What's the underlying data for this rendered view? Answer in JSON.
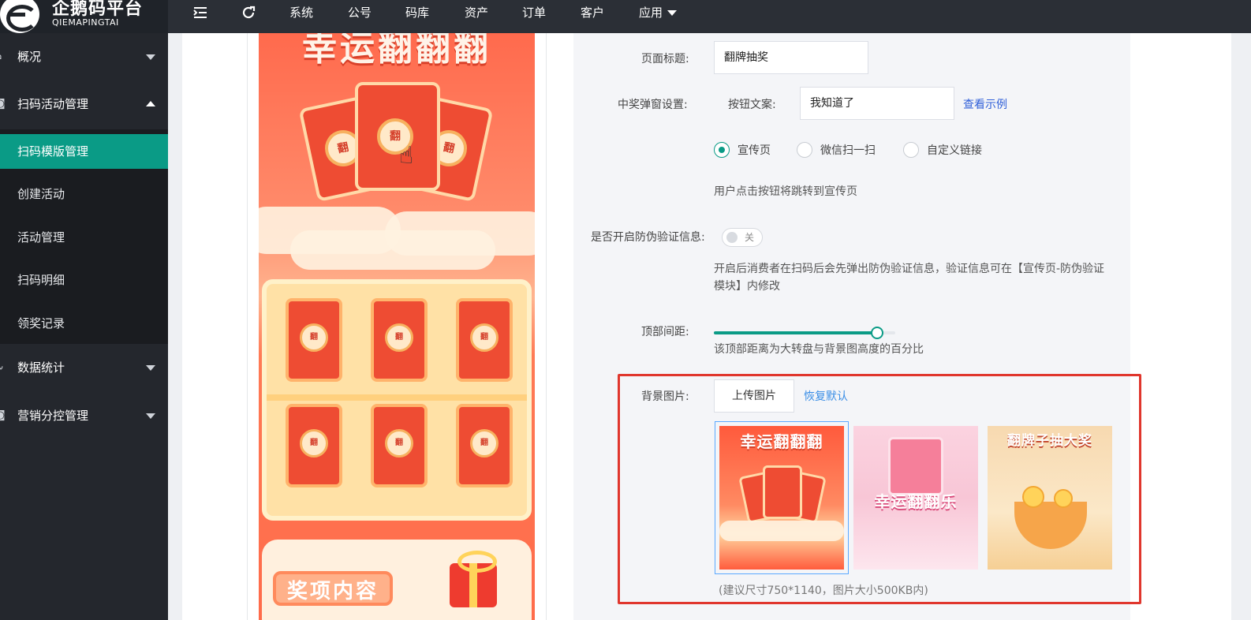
{
  "brand": {
    "name_cn": "企鹅码平台",
    "name_en": "QIEMAPINGTAI"
  },
  "topnav": {
    "items": [
      "系统",
      "公号",
      "码库",
      "资产",
      "订单",
      "客户",
      "应用"
    ],
    "icons": [
      "menu-fold-icon",
      "refresh-icon"
    ]
  },
  "sidebar": {
    "groups": [
      {
        "label": "概况",
        "icon": "home-icon",
        "expanded": false
      },
      {
        "label": "扫码活动管理",
        "icon": "camera-icon",
        "expanded": true
      },
      {
        "label": "数据统计",
        "icon": "pulse-icon",
        "expanded": false
      },
      {
        "label": "营销分控管理",
        "icon": "camera-icon",
        "expanded": false
      }
    ],
    "subitems": [
      "扫码模版管理",
      "创建活动",
      "活动管理",
      "扫码明细",
      "领奖记录"
    ],
    "active_subitem": "扫码模版管理"
  },
  "preview": {
    "title": "幸运翻翻翻",
    "card_text": "翻",
    "prize_label": "奖项内容"
  },
  "form": {
    "page_title_label": "页面标题:",
    "page_title_value": "翻牌抽奖",
    "popup_label": "中奖弹窗设置:",
    "button_text_label": "按钮文案:",
    "button_text_value": "我知道了",
    "view_example": "查看示例",
    "radios": [
      {
        "label": "宣传页",
        "checked": true
      },
      {
        "label": "微信扫一扫",
        "checked": false
      },
      {
        "label": "自定义链接",
        "checked": false
      }
    ],
    "redirect_hint": "用户点击按钮将跳转到宣传页",
    "anti_fake_label": "是否开启防伪验证信息:",
    "anti_fake_switch": "关",
    "anti_fake_on": false,
    "anti_fake_hint": "开启后消费者在扫码后会先弹出防伪验证信息，验证信息可在【宣传页-防伪验证模块】内修改",
    "top_spacing_label": "顶部间距:",
    "top_spacing_value": 0.9,
    "top_spacing_hint": "该顶部距离为大转盘与背景图高度的百分比",
    "bg_label": "背景图片:",
    "upload_button": "上传图片",
    "restore_default": "恢复默认",
    "thumbnails": [
      {
        "title": "幸运翻翻翻",
        "selected": true
      },
      {
        "title": "幸运翻翻乐",
        "selected": false
      },
      {
        "title": "翻牌子抽大奖",
        "selected": false
      }
    ],
    "size_hint": "(建议尺寸750*1140，图片大小500KB内)"
  },
  "colors": {
    "accent": "#0a9b86",
    "highlight": "#e0362d",
    "link": "#2f5fd8",
    "sidebar_bg": "#24272d"
  }
}
